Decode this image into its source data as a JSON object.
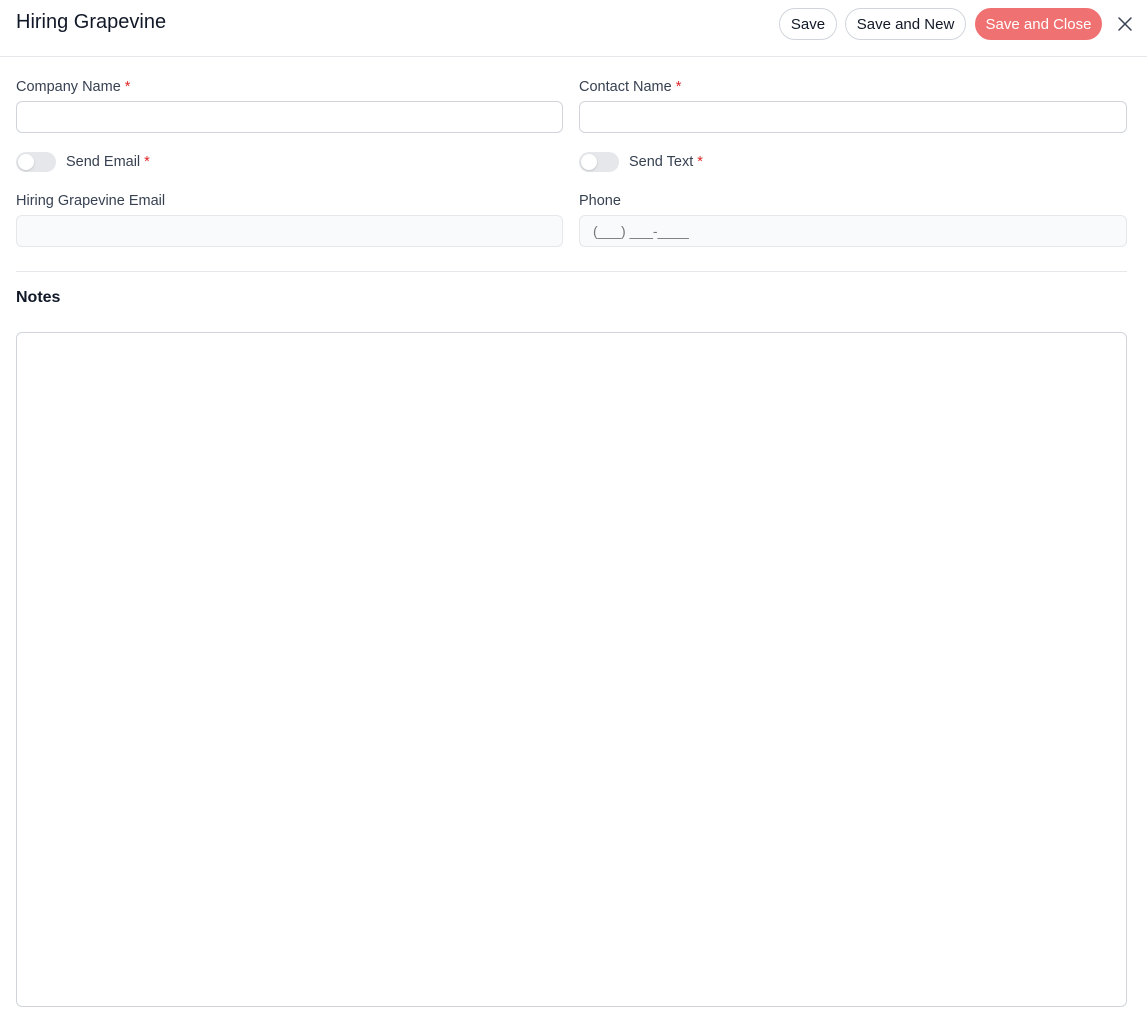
{
  "header": {
    "title": "Hiring Grapevine",
    "save_label": "Save",
    "save_new_label": "Save and New",
    "save_close_label": "Save and Close",
    "close_icon": "close-icon"
  },
  "form": {
    "company_name": {
      "label": "Company Name",
      "required_mark": "*",
      "value": ""
    },
    "contact_name": {
      "label": "Contact Name",
      "required_mark": "*",
      "value": ""
    },
    "send_email": {
      "label": "Send Email",
      "required_mark": "*",
      "enabled": false
    },
    "send_text": {
      "label": "Send Text",
      "required_mark": "*",
      "enabled": false
    },
    "hiring_email": {
      "label": "Hiring Grapevine Email",
      "value": ""
    },
    "phone": {
      "label": "Phone",
      "placeholder": "(___) ___-____",
      "value": ""
    }
  },
  "notes": {
    "title": "Notes",
    "value": ""
  },
  "colors": {
    "accent": "#f07171",
    "required": "#dc2626",
    "toggle_off": "#e5e7eb"
  }
}
